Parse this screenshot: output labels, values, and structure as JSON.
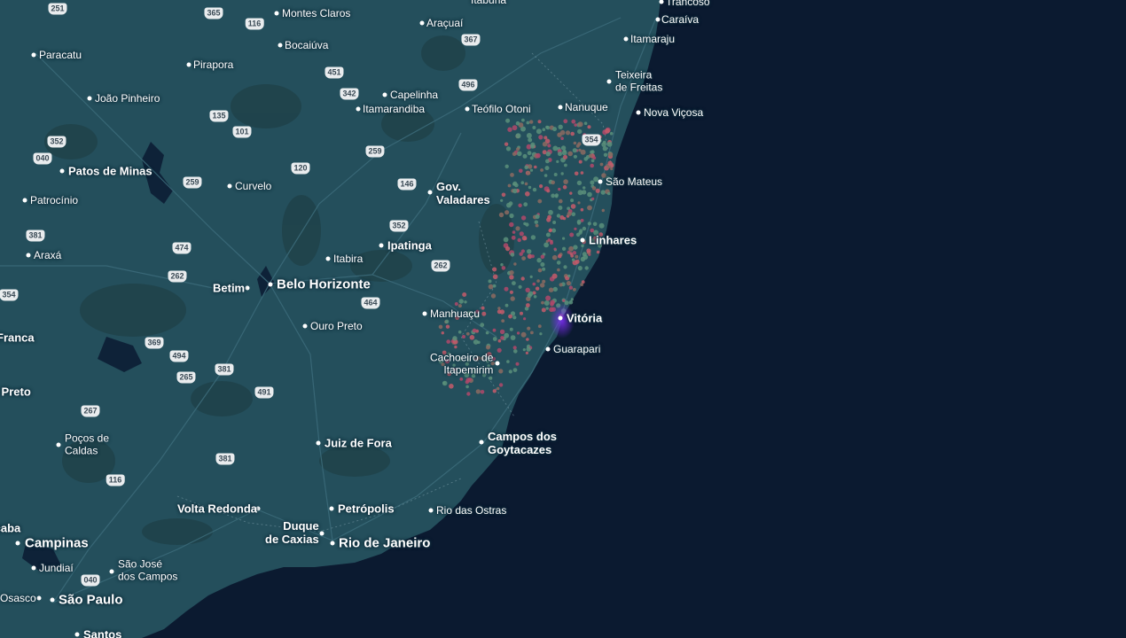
{
  "map": {
    "water_color": "#0b1a30",
    "land_color": "#244f5c",
    "heat_color_low": "#5a8f7a",
    "heat_color_mid": "#b0486a",
    "heat_color_high": "#6a2fd0"
  },
  "places": [
    {
      "name": "Montes Claros",
      "type": "minor"
    },
    {
      "name": "Bocaiúva",
      "type": "minor"
    },
    {
      "name": "Araçuaí",
      "type": "minor"
    },
    {
      "name": "Caraíva",
      "type": "minor"
    },
    {
      "name": "Itamaraju",
      "type": "minor"
    },
    {
      "name": "Paracatu",
      "type": "minor"
    },
    {
      "name": "Pirapora",
      "type": "minor"
    },
    {
      "name": "João Pinheiro",
      "type": "minor"
    },
    {
      "name": "Capelinha",
      "type": "minor"
    },
    {
      "name": "Itamarandiba",
      "type": "minor"
    },
    {
      "name": "Teófilo Otoni",
      "type": "minor"
    },
    {
      "name": "Nanuque",
      "type": "minor"
    },
    {
      "name": "Teixeira\nde Freitas",
      "type": "minor"
    },
    {
      "name": "Nova Viçosa",
      "type": "minor"
    },
    {
      "name": "Patos de Minas",
      "type": "mid"
    },
    {
      "name": "Curvelo",
      "type": "minor"
    },
    {
      "name": "Gov.\nValadares",
      "type": "mid"
    },
    {
      "name": "São Mateus",
      "type": "minor"
    },
    {
      "name": "Patrocínio",
      "type": "minor"
    },
    {
      "name": "Linhares",
      "type": "mid"
    },
    {
      "name": "Ipatinga",
      "type": "mid"
    },
    {
      "name": "Itabira",
      "type": "minor"
    },
    {
      "name": "Araxá",
      "type": "minor"
    },
    {
      "name": "Betim",
      "type": "mid"
    },
    {
      "name": "Belo Horizonte",
      "type": "major"
    },
    {
      "name": "Manhuaçu",
      "type": "minor"
    },
    {
      "name": "Vitória",
      "type": "mid"
    },
    {
      "name": "Ouro Preto",
      "type": "minor"
    },
    {
      "name": "Franca",
      "type": "mid"
    },
    {
      "name": "Guarapari",
      "type": "minor"
    },
    {
      "name": "Cachoeiro de\nItapemirim",
      "type": "minor"
    },
    {
      "name": "o Preto",
      "type": "mid"
    },
    {
      "name": "Poços de\nCaldas",
      "type": "minor"
    },
    {
      "name": "Juiz de Fora",
      "type": "mid"
    },
    {
      "name": "Campos dos\nGoytacazes",
      "type": "mid"
    },
    {
      "name": "Volta Redonda",
      "type": "mid"
    },
    {
      "name": "Petrópolis",
      "type": "mid"
    },
    {
      "name": "Rio das Ostras",
      "type": "minor"
    },
    {
      "name": "icaba",
      "type": "mid"
    },
    {
      "name": "Campinas",
      "type": "major"
    },
    {
      "name": "Duque\nde Caxias",
      "type": "mid"
    },
    {
      "name": "Rio de Janeiro",
      "type": "major"
    },
    {
      "name": "Jundiaí",
      "type": "minor"
    },
    {
      "name": "São José\ndos Campos",
      "type": "minor"
    },
    {
      "name": "Osasco",
      "type": "minor"
    },
    {
      "name": "São Paulo",
      "type": "major"
    },
    {
      "name": "Santos",
      "type": "mid"
    },
    {
      "name": "Trancoso",
      "type": "minor"
    },
    {
      "name": "Itabuna",
      "type": "minor"
    }
  ],
  "highways": [
    "251",
    "365",
    "116",
    "367",
    "451",
    "342",
    "496",
    "135",
    "101",
    "354",
    "352",
    "040",
    "259",
    "120",
    "259",
    "146",
    "381",
    "352",
    "474",
    "262",
    "262",
    "464",
    "354",
    "369",
    "494",
    "381",
    "265",
    "491",
    "267",
    "381",
    "116",
    "040"
  ]
}
